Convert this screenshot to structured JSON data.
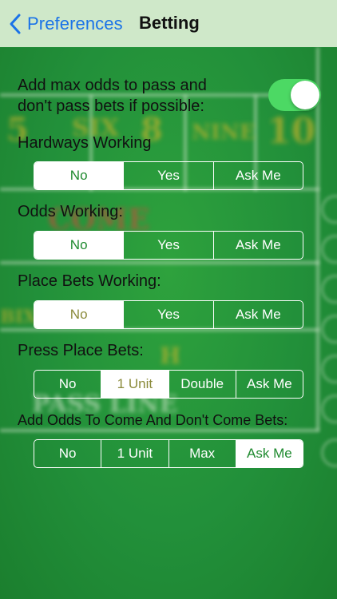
{
  "nav": {
    "back_label": "Preferences",
    "title": "Betting"
  },
  "max_odds": {
    "label_line1": "Add max odds to pass and",
    "label_line2": "don't pass bets if possible:",
    "enabled": true
  },
  "hardways": {
    "label": "Hardways Working",
    "options": [
      "No",
      "Yes",
      "Ask Me"
    ],
    "selected": "No"
  },
  "odds": {
    "label": "Odds Working:",
    "options": [
      "No",
      "Yes",
      "Ask Me"
    ],
    "selected": "No"
  },
  "place": {
    "label": "Place Bets Working:",
    "options": [
      "No",
      "Yes",
      "Ask Me"
    ],
    "selected": "No"
  },
  "press": {
    "label": "Press Place Bets:",
    "options": [
      "No",
      "1 Unit",
      "Double",
      "Ask Me"
    ],
    "selected": "1 Unit"
  },
  "come_odds": {
    "label": "Add Odds To Come And Don't Come Bets:",
    "options": [
      "No",
      "1 Unit",
      "Max",
      "Ask Me"
    ],
    "selected": "Ask Me"
  },
  "colors": {
    "felt": "#1f8a2f",
    "navbar": "#cfe8c9",
    "accent": "#1a73e8",
    "toggle_on": "#4cd964"
  }
}
